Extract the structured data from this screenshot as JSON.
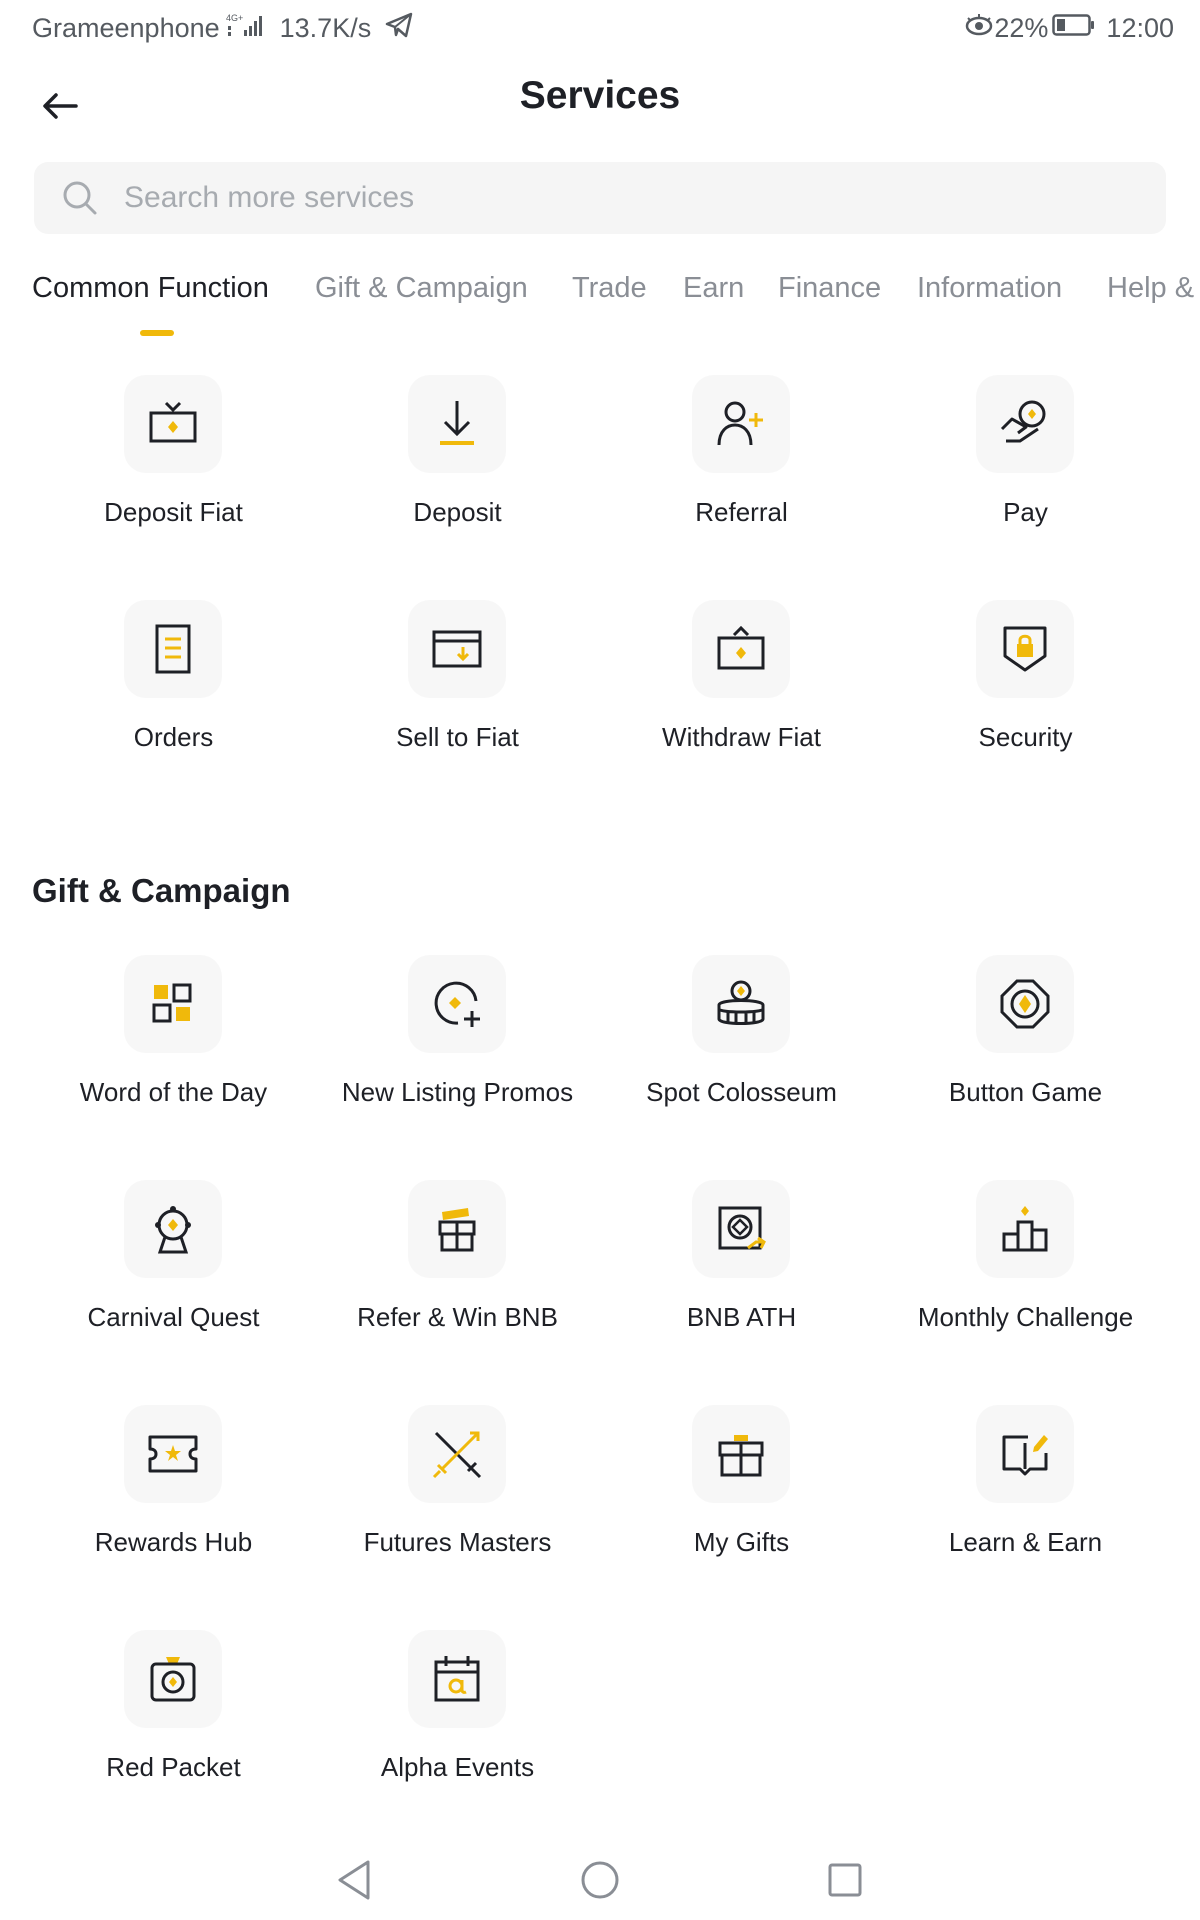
{
  "status_bar": {
    "carrier": "Grameenphone",
    "speed": "13.7K/s",
    "battery": "22%",
    "time": "12:00"
  },
  "header": {
    "title": "Services"
  },
  "search": {
    "placeholder": "Search more services"
  },
  "tabs": [
    {
      "label": "Common Function",
      "active": true
    },
    {
      "label": "Gift & Campaign"
    },
    {
      "label": "Trade"
    },
    {
      "label": "Earn"
    },
    {
      "label": "Finance"
    },
    {
      "label": "Information"
    },
    {
      "label": "Help &"
    }
  ],
  "common_function": {
    "items": [
      {
        "label": "Deposit Fiat",
        "icon": "deposit-fiat-icon"
      },
      {
        "label": "Deposit",
        "icon": "deposit-icon"
      },
      {
        "label": "Referral",
        "icon": "referral-icon"
      },
      {
        "label": "Pay",
        "icon": "pay-icon"
      },
      {
        "label": "Orders",
        "icon": "orders-icon"
      },
      {
        "label": "Sell to Fiat",
        "icon": "sell-to-fiat-icon"
      },
      {
        "label": "Withdraw Fiat",
        "icon": "withdraw-fiat-icon"
      },
      {
        "label": "Security",
        "icon": "security-icon"
      }
    ]
  },
  "gift_campaign": {
    "title": "Gift & Campaign",
    "items": [
      {
        "label": "Word of the Day",
        "icon": "word-of-the-day-icon"
      },
      {
        "label": "New Listing Promos",
        "icon": "new-listing-promos-icon"
      },
      {
        "label": "Spot Colosseum",
        "icon": "spot-colosseum-icon"
      },
      {
        "label": "Button Game",
        "icon": "button-game-icon"
      },
      {
        "label": "Carnival Quest",
        "icon": "carnival-quest-icon"
      },
      {
        "label": "Refer & Win BNB",
        "icon": "refer-win-bnb-icon"
      },
      {
        "label": "BNB ATH",
        "icon": "bnb-ath-icon"
      },
      {
        "label": "Monthly Challenge",
        "icon": "monthly-challenge-icon"
      },
      {
        "label": "Rewards Hub",
        "icon": "rewards-hub-icon"
      },
      {
        "label": "Futures Masters",
        "icon": "futures-masters-icon"
      },
      {
        "label": "My Gifts",
        "icon": "my-gifts-icon"
      },
      {
        "label": "Learn & Earn",
        "icon": "learn-earn-icon"
      },
      {
        "label": "Red Packet",
        "icon": "red-packet-icon"
      },
      {
        "label": "Alpha Events",
        "icon": "alpha-events-icon"
      }
    ]
  },
  "colors": {
    "accent": "#f0b90b",
    "text": "#1e2026",
    "muted": "#8a8e95",
    "tile_bg": "#f7f7f7"
  }
}
